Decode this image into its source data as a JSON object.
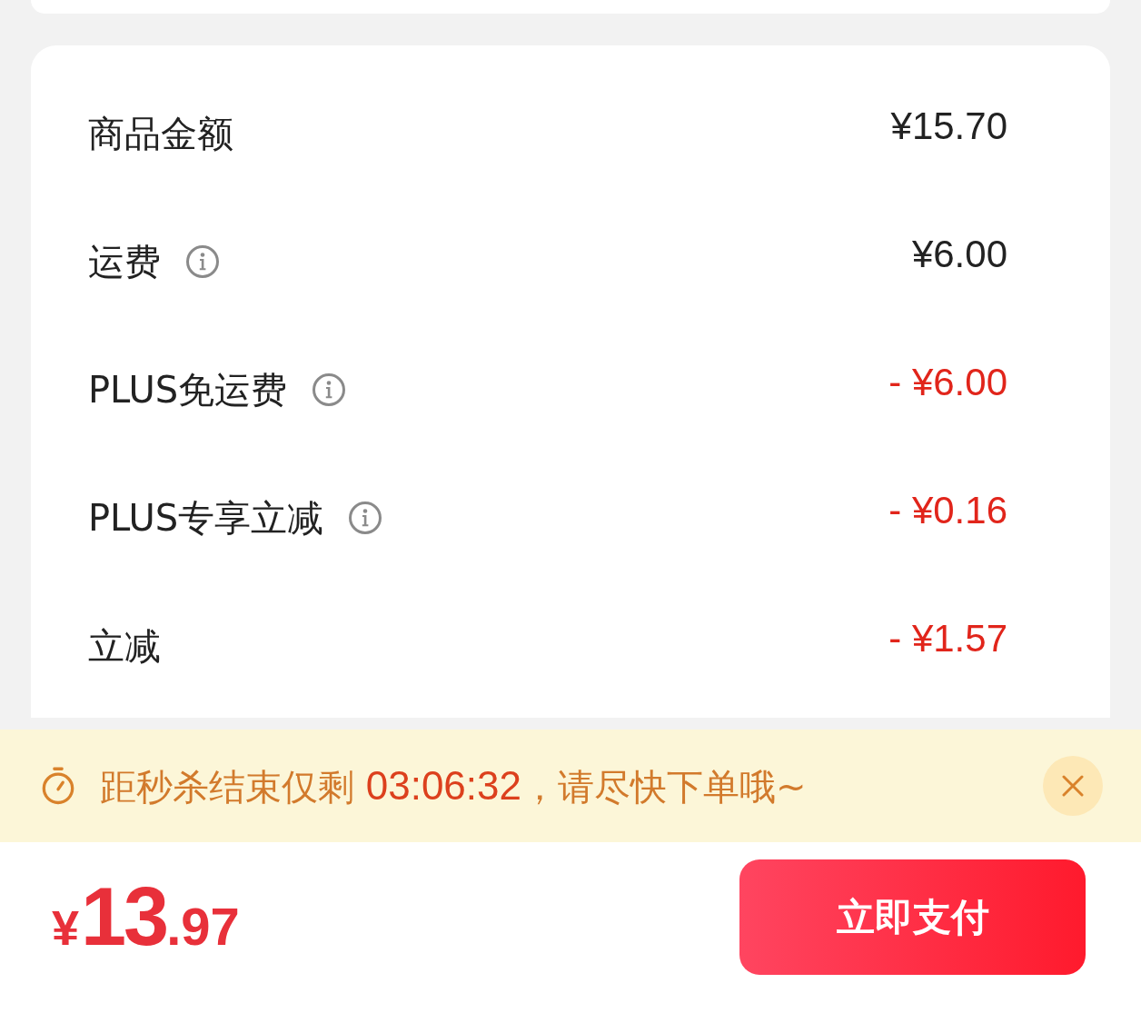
{
  "summary": {
    "rows": [
      {
        "label": "商品金额",
        "info": false,
        "kind": "charge",
        "amount": "¥15.70"
      },
      {
        "label": "运费",
        "info": true,
        "kind": "charge",
        "amount": "¥6.00"
      },
      {
        "label": "PLUS免运费",
        "info": true,
        "kind": "discount",
        "amount": "- ¥6.00"
      },
      {
        "label": "PLUS专享立减",
        "info": true,
        "kind": "discount",
        "amount": "- ¥0.16"
      },
      {
        "label": "立减",
        "info": false,
        "kind": "discount",
        "amount": "- ¥1.57"
      }
    ]
  },
  "countdown_banner": {
    "prefix": "距秒杀结束仅剩",
    "countdown": "03:06:32",
    "suffix": "，请尽快下单哦~"
  },
  "checkout": {
    "total": {
      "currency": "¥",
      "integer": "13",
      "decimal": ".97"
    },
    "pay_button": "立即支付"
  }
}
